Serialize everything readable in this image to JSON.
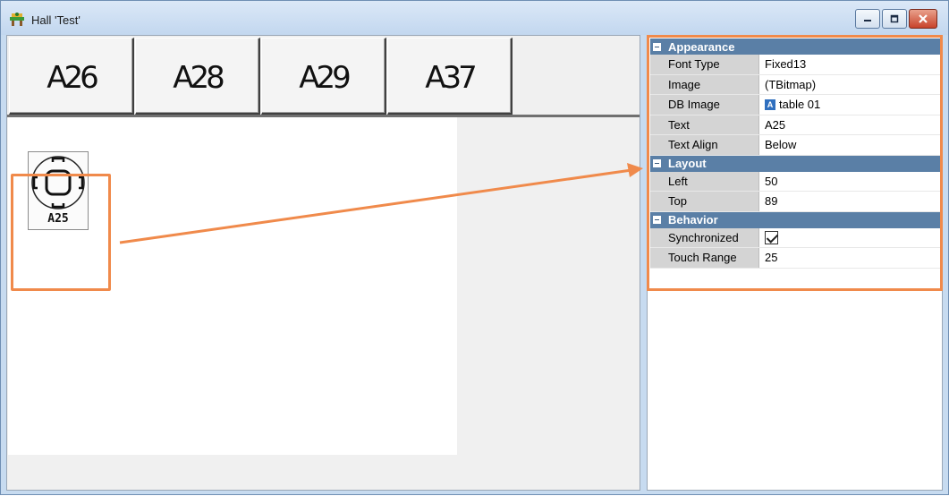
{
  "window": {
    "title": "Hall 'Test'",
    "buttons": [
      "minimize",
      "maximize",
      "close"
    ]
  },
  "tables": [
    {
      "label": "A26"
    },
    {
      "label": "A28"
    },
    {
      "label": "A29"
    },
    {
      "label": "A37"
    }
  ],
  "selected_table": {
    "caption": "A25"
  },
  "inspector": {
    "categories": [
      {
        "name": "Appearance",
        "rows": [
          {
            "name": "Font Type",
            "value": "Fixed13"
          },
          {
            "name": "Image",
            "value": "(TBitmap)"
          },
          {
            "name": "DB Image",
            "value": "table 01",
            "icon": "db-image-icon"
          },
          {
            "name": "Text",
            "value": "A25"
          },
          {
            "name": "Text Align",
            "value": "Below"
          }
        ]
      },
      {
        "name": "Layout",
        "rows": [
          {
            "name": "Left",
            "value": "50"
          },
          {
            "name": "Top",
            "value": "89"
          }
        ]
      },
      {
        "name": "Behavior",
        "rows": [
          {
            "name": "Synchronized",
            "checked": true
          },
          {
            "name": "Touch Range",
            "value": "25"
          }
        ]
      }
    ]
  },
  "colors": {
    "highlight": "#f08a4b",
    "category_header": "#5a7fa6"
  }
}
